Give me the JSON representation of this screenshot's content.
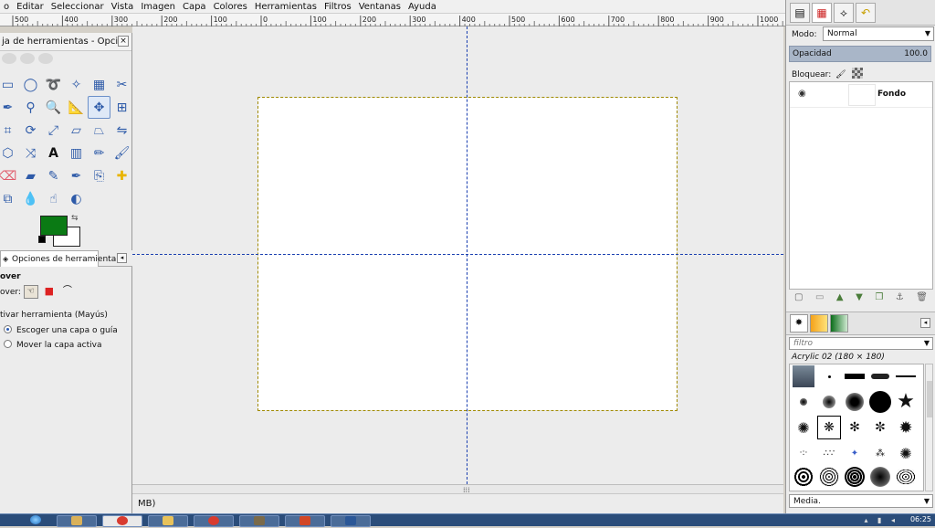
{
  "menu": [
    "o",
    "Editar",
    "Seleccionar",
    "Vista",
    "Imagen",
    "Capa",
    "Colores",
    "Herramientas",
    "Filtros",
    "Ventanas",
    "Ayuda"
  ],
  "ruler": {
    "labels": [
      "500",
      "400",
      "300",
      "200",
      "100",
      "0",
      "100",
      "200",
      "300",
      "400",
      "500",
      "600",
      "700",
      "800",
      "900",
      "1000"
    ]
  },
  "toolbox": {
    "title": "ja de herramientas - Opcion",
    "close_label": "×",
    "tools": [
      "rect-select-icon",
      "ellipse-select-icon",
      "lasso-icon",
      "fuzzy-select-icon",
      "color-select-icon",
      "scissors-icon",
      "paths-icon",
      "color-picker-icon",
      "zoom-icon",
      "measure-icon",
      "move-icon",
      "align-icon",
      "crop-icon",
      "rotate-icon",
      "scale-icon",
      "shear-icon",
      "perspective-icon",
      "flip-icon",
      "cage-icon",
      "warp-icon",
      "text-icon",
      "blend-icon",
      "pencil-icon",
      "paintbrush-icon",
      "eraser-icon",
      "eraser2-icon",
      "airbrush-icon",
      "ink-icon",
      "clone-icon",
      "heal-icon",
      "perspective-clone-icon",
      "blur-icon",
      "smudge-icon",
      "dodge-icon"
    ],
    "selected_tool": "move-icon",
    "fg_color": "#0a7a14",
    "bg_color": "#ffffff",
    "options_tab": "Opciones de herramienta",
    "options": {
      "tool_name": "over",
      "mode_label": "over:",
      "activate_label": "tivar herramienta  (Mayús)",
      "radio1": "Escoger una capa o guía",
      "radio2": "Mover la capa activa"
    }
  },
  "statusbar": {
    "text": "MB)"
  },
  "dock": {
    "mode_label": "Modo:",
    "mode_value": "Normal",
    "opacity_label": "Opacidad",
    "opacity_value": "100.0",
    "lock_label": "Bloquear:",
    "layers": [
      {
        "name": "Fondo",
        "visible": true
      }
    ],
    "filter_placeholder": "filtro",
    "brush_name": "Acrylic 02 (180 × 180)",
    "media_label": "Media."
  },
  "taskbar": {
    "time": "06:25"
  }
}
